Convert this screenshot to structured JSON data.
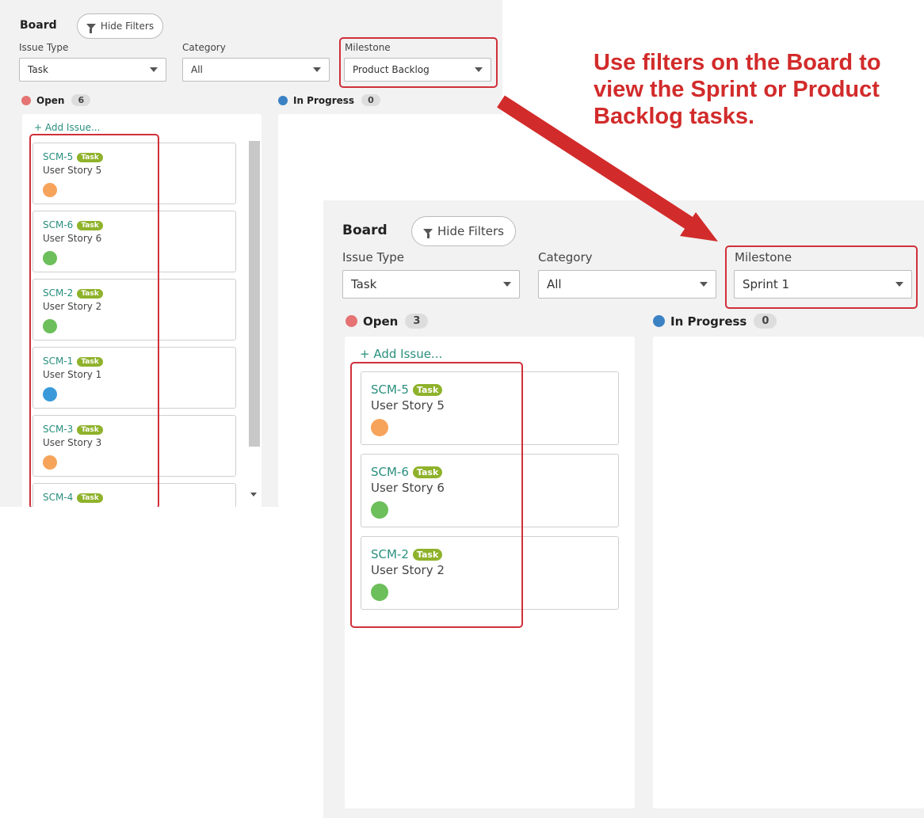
{
  "back": {
    "title": "Board",
    "hide_filters": "Hide Filters",
    "issue_type_label": "Issue Type",
    "issue_type_value": "Task",
    "category_label": "Category",
    "category_value": "All",
    "milestone_label": "Milestone",
    "milestone_value": "Product Backlog",
    "open_label": "Open",
    "open_count": "6",
    "inprogress_label": "In Progress",
    "inprogress_count": "0",
    "add_issue": "+ Add Issue...",
    "cards": [
      {
        "key": "SCM-5",
        "tag": "Task",
        "summary": "User Story 5"
      },
      {
        "key": "SCM-6",
        "tag": "Task",
        "summary": "User Story 6"
      },
      {
        "key": "SCM-2",
        "tag": "Task",
        "summary": "User Story 2"
      },
      {
        "key": "SCM-1",
        "tag": "Task",
        "summary": "User Story 1"
      },
      {
        "key": "SCM-3",
        "tag": "Task",
        "summary": "User Story 3"
      },
      {
        "key": "SCM-4",
        "tag": "Task",
        "summary": ""
      }
    ]
  },
  "front": {
    "title": "Board",
    "hide_filters": "Hide Filters",
    "issue_type_label": "Issue Type",
    "issue_type_value": "Task",
    "category_label": "Category",
    "category_value": "All",
    "milestone_label": "Milestone",
    "milestone_value": "Sprint 1",
    "open_label": "Open",
    "open_count": "3",
    "inprogress_label": "In Progress",
    "inprogress_count": "0",
    "add_issue": "+ Add Issue...",
    "cards": [
      {
        "key": "SCM-5",
        "tag": "Task",
        "summary": "User Story 5"
      },
      {
        "key": "SCM-6",
        "tag": "Task",
        "summary": "User Story 6"
      },
      {
        "key": "SCM-2",
        "tag": "Task",
        "summary": "User Story 2"
      }
    ]
  },
  "annotation": "Use filters on the Board to view the Sprint or Product Backlog tasks.",
  "colors": {
    "accent_red": "#d22b2b",
    "open_dot": "#e57373",
    "inprogress_dot": "#3b82c4",
    "link_teal": "#2a8f7e",
    "task_tag": "#8fb22b"
  },
  "icons": {
    "filter": "funnel-icon",
    "dropdown": "caret-down-icon",
    "arrow": "red-arrow"
  }
}
